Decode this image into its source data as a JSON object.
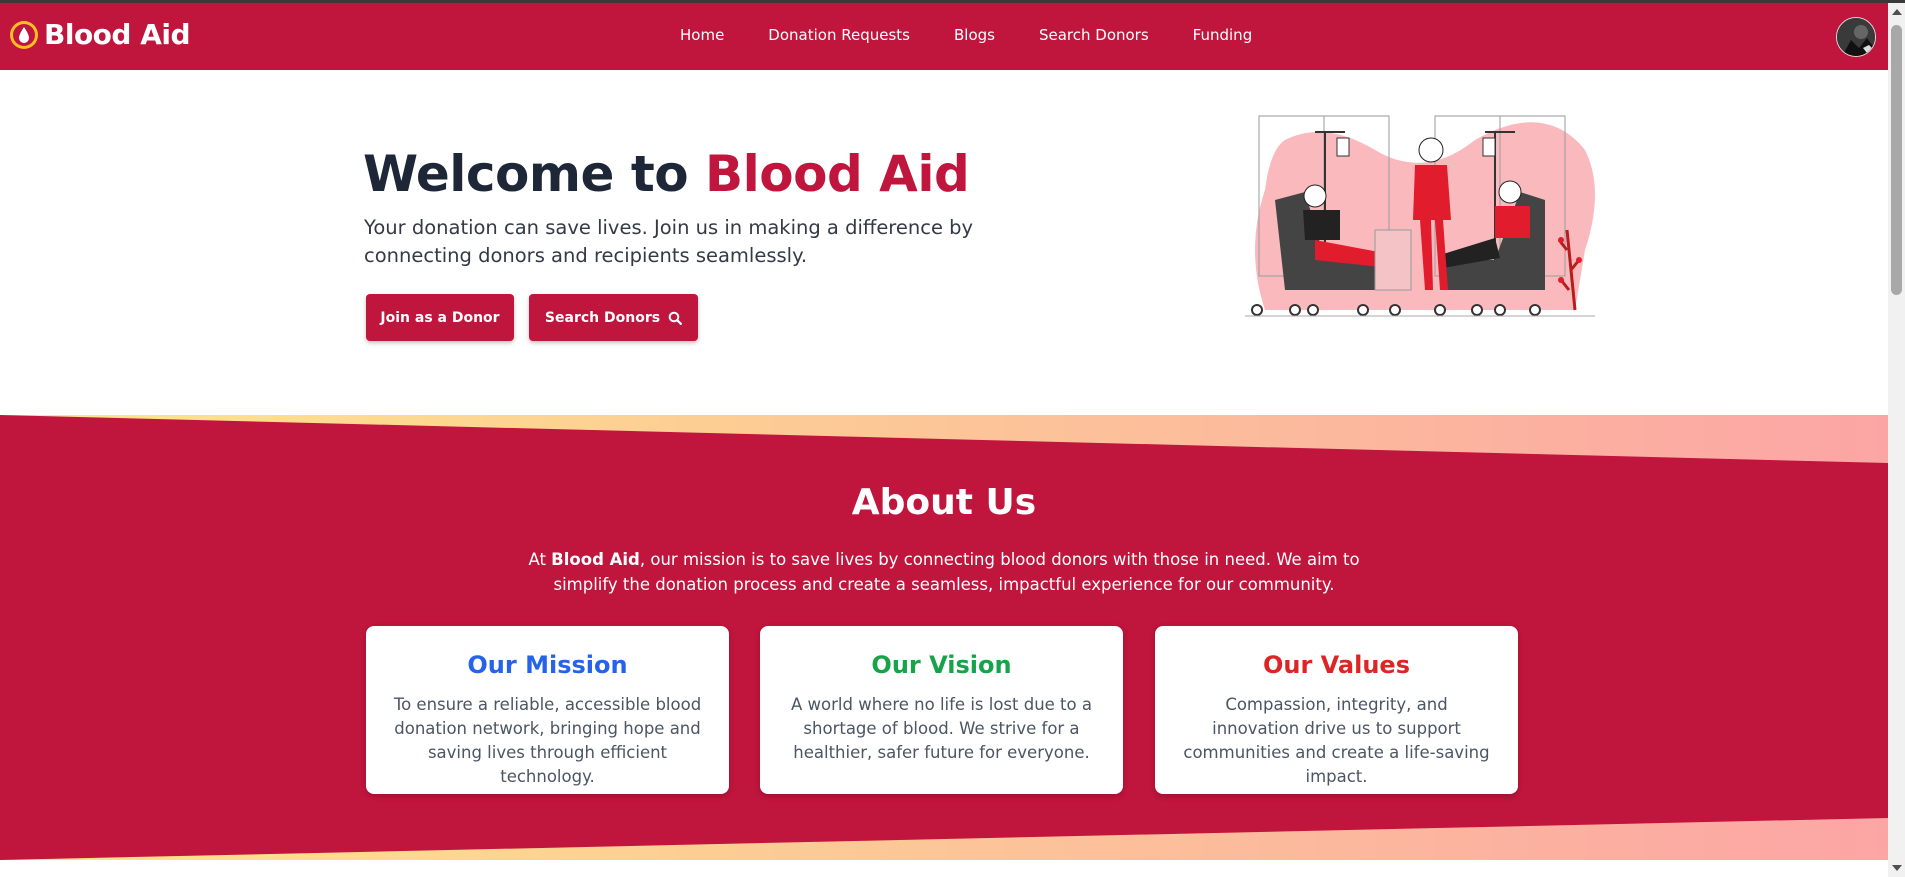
{
  "brand": {
    "name": "Blood Aid",
    "color": "#c0153c"
  },
  "nav": {
    "items": [
      {
        "label": "Home"
      },
      {
        "label": "Donation Requests"
      },
      {
        "label": "Blogs"
      },
      {
        "label": "Search Donors"
      },
      {
        "label": "Funding"
      }
    ]
  },
  "hero": {
    "title_prefix": "Welcome to ",
    "title_accent": "Blood Aid",
    "text": "Your donation can save lives. Join us in making a difference by connecting donors and recipients seamlessly.",
    "join_label": "Join as a Donor",
    "search_label": "Search Donors",
    "search_icon": "search-icon"
  },
  "about": {
    "title": "About Us",
    "text_pre": "At ",
    "text_bold": "Blood Aid",
    "text_post": ", our mission is to save lives by connecting blood donors with those in need. We aim to simplify the donation process and create a seamless, impactful experience for our community.",
    "cards": [
      {
        "title": "Our Mission",
        "color": "#2563eb",
        "text": "To ensure a reliable, accessible blood donation network, bringing hope and saving lives through efficient technology."
      },
      {
        "title": "Our Vision",
        "color": "#16a34a",
        "text": "A world where no life is lost due to a shortage of blood. We strive for a healthier, safer future for everyone."
      },
      {
        "title": "Our Values",
        "color": "#dc2626",
        "text": "Compassion, integrity, and innovation drive us to support communities and create a life-saving impact."
      }
    ]
  }
}
